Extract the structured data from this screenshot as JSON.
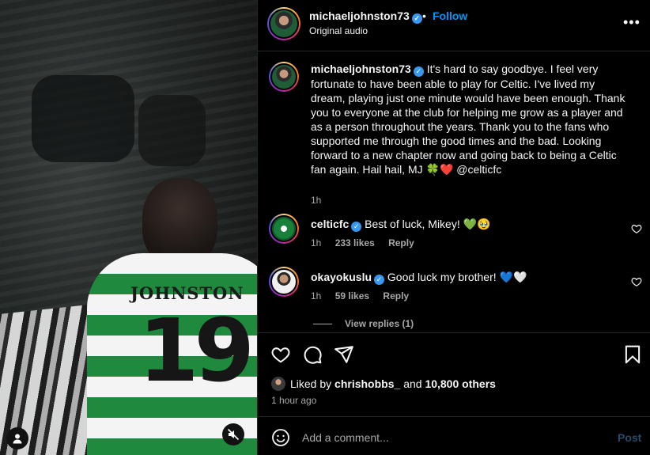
{
  "post": {
    "username": "michaeljohnston73",
    "follow_label": "Follow",
    "separator": "•",
    "audio": "Original audio",
    "more_label": "•••"
  },
  "video": {
    "shirt_name": "JOHNSTON",
    "shirt_number": "19"
  },
  "caption": {
    "username": "michaeljohnston73",
    "text": "It's hard to say goodbye. I feel very fortunate to have been able to play for Celtic. I've lived my dream, playing just one minute would have been enough. Thank you to everyone at the club for helping me grow as a player and as a person throughout the years. Thank you to the fans who supported me through the good times and the bad. Looking forward to a new chapter now and going back to being a Celtic fan again. Hail hail, MJ 🍀❤️ @celticfc",
    "time": "1h"
  },
  "comments": [
    {
      "username": "celticfc",
      "text": "Best of luck, Mikey! 💚🥹",
      "time": "1h",
      "likes": "233 likes",
      "reply_label": "Reply"
    },
    {
      "username": "okayokuslu",
      "text": "Good luck my brother! 💙🤍",
      "time": "1h",
      "likes": "59 likes",
      "reply_label": "Reply"
    }
  ],
  "view_replies": "View replies (1)",
  "likes": {
    "prefix": "Liked by",
    "user": "chrishobbs_",
    "and": "and",
    "others": "10,800 others"
  },
  "timestamp": "1 hour ago",
  "composer": {
    "placeholder": "Add a comment...",
    "post_label": "Post"
  },
  "colors": {
    "link_blue": "#0095f6",
    "verified_blue": "#3897f0",
    "muted": "#a8a8a8"
  }
}
